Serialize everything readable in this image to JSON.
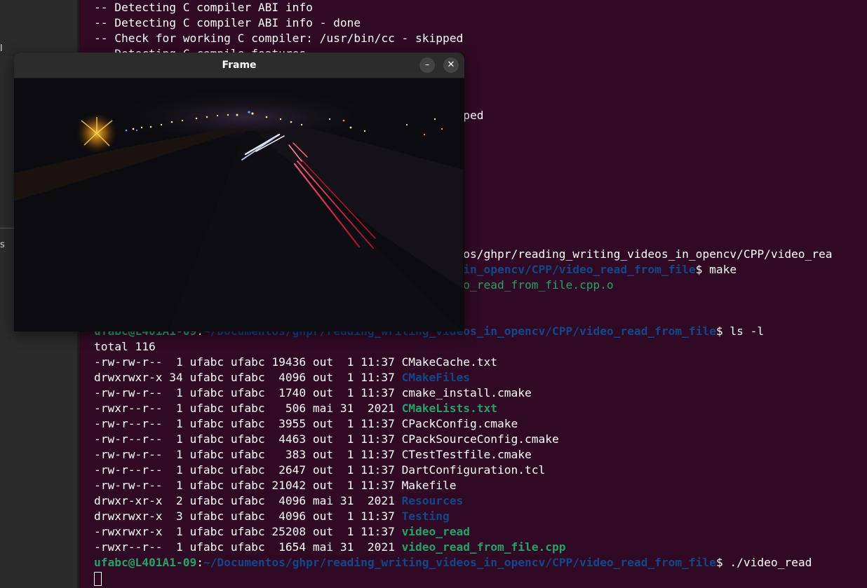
{
  "left_panel": {
    "fragment_top": "l",
    "fragment_bottom": "s"
  },
  "frame_window": {
    "title": "Frame",
    "minimize_icon": "–",
    "close_icon": "✕"
  },
  "terminal": {
    "prompt_user": "ufabc@L401A1-09",
    "prompt_path": "~/Documentos/ghpr/reading_writing_videos_in_opencv/CPP/video_read_from_file",
    "lines": [
      {
        "segments": [
          {
            "text": "-- Detecting C compiler ABI info",
            "style": "plain"
          }
        ]
      },
      {
        "segments": [
          {
            "text": "-- Detecting C compiler ABI info - done",
            "style": "plain"
          }
        ]
      },
      {
        "segments": [
          {
            "text": "-- Check for working C compiler: /usr/bin/cc - skipped",
            "style": "plain"
          }
        ]
      },
      {
        "segments": [
          {
            "text": "-- Detecting C compile features",
            "style": "plain"
          }
        ]
      },
      {
        "segments": [
          {
            "text": "",
            "style": "plain"
          }
        ]
      },
      {
        "segments": [
          {
            "text": "",
            "style": "plain"
          }
        ]
      },
      {
        "segments": [
          {
            "text": "",
            "style": "plain"
          }
        ]
      },
      {
        "segments": [
          {
            "text": "                                                     pped",
            "style": "plain"
          }
        ]
      },
      {
        "segments": [
          {
            "text": "",
            "style": "plain"
          }
        ]
      },
      {
        "segments": [
          {
            "text": "",
            "style": "plain"
          }
        ]
      },
      {
        "segments": [
          {
            "text": "",
            "style": "plain"
          }
        ]
      },
      {
        "segments": [
          {
            "text": "",
            "style": "plain"
          }
        ]
      },
      {
        "segments": [
          {
            "text": "",
            "style": "plain"
          }
        ]
      },
      {
        "segments": [
          {
            "text": "",
            "style": "plain"
          }
        ]
      },
      {
        "segments": [
          {
            "text": "",
            "style": "plain"
          }
        ]
      },
      {
        "segments": [
          {
            "text": "",
            "style": "plain"
          }
        ]
      },
      {
        "segments": [
          {
            "text": "                                                  mentos/ghpr/reading_writing_videos_in_opencv/CPP/video_rea",
            "style": "plain"
          }
        ]
      },
      {
        "segments": [
          {
            "text": "                                                  eos_in_opencv/CPP/video_read_from_file",
            "style": "blue"
          },
          {
            "text": "$ make",
            "style": "plain"
          }
        ]
      },
      {
        "segments": [
          {
            "text": "                                                  video_read_from_file.cpp.o",
            "style": "green_plain"
          }
        ]
      },
      {
        "segments": [
          {
            "text": "",
            "style": "plain"
          }
        ]
      },
      {
        "segments": [
          {
            "text": "",
            "style": "plain"
          }
        ]
      },
      {
        "segments": [
          {
            "text": "ufabc@L401A1-09",
            "style": "green"
          },
          {
            "text": ":",
            "style": "plain"
          },
          {
            "text": "~/Documentos/ghpr/reading_writing_videos_in_opencv/CPP/video_read_from_file",
            "style": "blue"
          },
          {
            "text": "$ ls -l",
            "style": "plain"
          }
        ]
      },
      {
        "segments": [
          {
            "text": "total 116",
            "style": "plain"
          }
        ]
      },
      {
        "segments": [
          {
            "text": "-rw-rw-r--  1 ufabc ufabc 19436 out  1 11:37 ",
            "style": "plain"
          },
          {
            "text": "CMakeCache.txt",
            "style": "plain"
          }
        ]
      },
      {
        "segments": [
          {
            "text": "drwxrwxr-x 34 ufabc ufabc  4096 out  1 11:37 ",
            "style": "plain"
          },
          {
            "text": "CMakeFiles",
            "style": "blue"
          }
        ]
      },
      {
        "segments": [
          {
            "text": "-rw-rw-r--  1 ufabc ufabc  1740 out  1 11:37 ",
            "style": "plain"
          },
          {
            "text": "cmake_install.cmake",
            "style": "plain"
          }
        ]
      },
      {
        "segments": [
          {
            "text": "-rwxr--r--  1 ufabc ufabc   506 mai 31  2021 ",
            "style": "plain"
          },
          {
            "text": "CMakeLists.txt",
            "style": "green"
          }
        ]
      },
      {
        "segments": [
          {
            "text": "-rw-r--r--  1 ufabc ufabc  3955 out  1 11:37 ",
            "style": "plain"
          },
          {
            "text": "CPackConfig.cmake",
            "style": "plain"
          }
        ]
      },
      {
        "segments": [
          {
            "text": "-rw-r--r--  1 ufabc ufabc  4463 out  1 11:37 ",
            "style": "plain"
          },
          {
            "text": "CPackSourceConfig.cmake",
            "style": "plain"
          }
        ]
      },
      {
        "segments": [
          {
            "text": "-rw-rw-r--  1 ufabc ufabc   383 out  1 11:37 ",
            "style": "plain"
          },
          {
            "text": "CTestTestfile.cmake",
            "style": "plain"
          }
        ]
      },
      {
        "segments": [
          {
            "text": "-rw-r--r--  1 ufabc ufabc  2647 out  1 11:37 ",
            "style": "plain"
          },
          {
            "text": "DartConfiguration.tcl",
            "style": "plain"
          }
        ]
      },
      {
        "segments": [
          {
            "text": "-rw-rw-r--  1 ufabc ufabc 21042 out  1 11:37 ",
            "style": "plain"
          },
          {
            "text": "Makefile",
            "style": "plain"
          }
        ]
      },
      {
        "segments": [
          {
            "text": "drwxr-xr-x  2 ufabc ufabc  4096 mai 31  2021 ",
            "style": "plain"
          },
          {
            "text": "Resources",
            "style": "blue"
          }
        ]
      },
      {
        "segments": [
          {
            "text": "drwxrwxr-x  3 ufabc ufabc  4096 out  1 11:37 ",
            "style": "plain"
          },
          {
            "text": "Testing",
            "style": "blue"
          }
        ]
      },
      {
        "segments": [
          {
            "text": "-rwxrwxr-x  1 ufabc ufabc 25208 out  1 11:37 ",
            "style": "plain"
          },
          {
            "text": "video_read",
            "style": "green"
          }
        ]
      },
      {
        "segments": [
          {
            "text": "-rwxr--r--  1 ufabc ufabc  1654 mai 31  2021 ",
            "style": "plain"
          },
          {
            "text": "video_read_from_file.cpp",
            "style": "green"
          }
        ]
      },
      {
        "segments": [
          {
            "text": "ufabc@L401A1-09",
            "style": "green"
          },
          {
            "text": ":",
            "style": "plain"
          },
          {
            "text": "~/Documentos/ghpr/reading_writing_videos_in_opencv/CPP/video_read_from_file",
            "style": "blue"
          },
          {
            "text": "$ ./video_read",
            "style": "plain"
          }
        ]
      }
    ]
  },
  "colors": {
    "terminal_bg": "#300a24",
    "prompt_green": "#26a269",
    "path_blue": "#12488b",
    "text": "#ffffff"
  }
}
